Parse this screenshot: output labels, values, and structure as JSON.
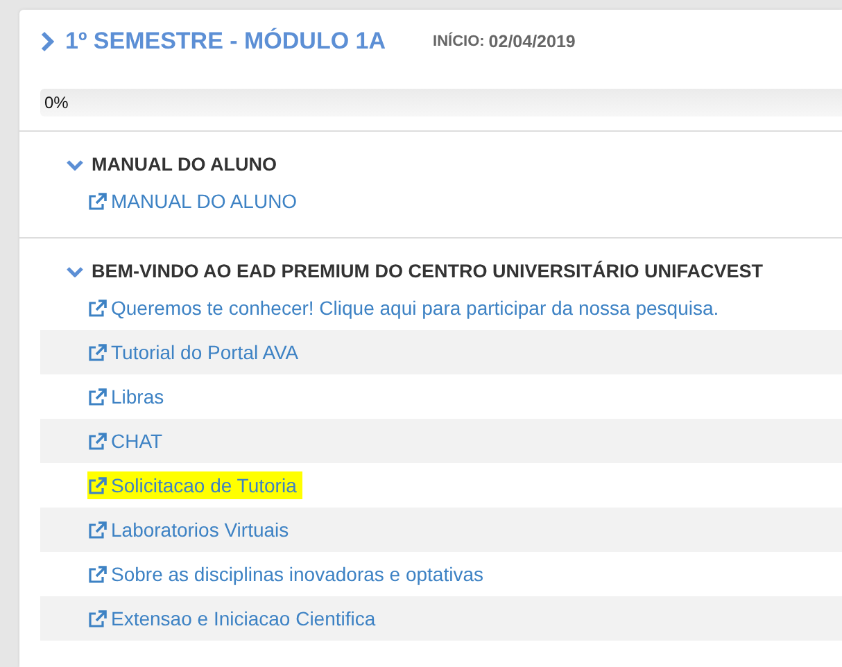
{
  "course": {
    "title": "1º SEMESTRE - MÓDULO 1A",
    "start_label": "INÍCIO:",
    "start_date": "02/04/2019"
  },
  "progress": {
    "level": 0,
    "reading": "0%"
  },
  "sections": [
    {
      "title": "MANUAL DO ALUNO",
      "expanded": true,
      "links": [
        {
          "label": "MANUAL DO ALUNO",
          "highlighted": false
        }
      ]
    },
    {
      "title": "BEM-VINDO AO EAD PREMIUM DO CENTRO UNIVERSITÁRIO UNIFACVEST",
      "expanded": true,
      "links": [
        {
          "label": "Queremos te conhecer! Clique aqui para participar da nossa pesquisa.",
          "highlighted": false
        },
        {
          "label": "Tutorial do Portal AVA",
          "highlighted": false
        },
        {
          "label": "Libras",
          "highlighted": false
        },
        {
          "label": "CHAT",
          "highlighted": false
        },
        {
          "label": "Solicitacao de Tutoria",
          "highlighted": true
        },
        {
          "label": "Laboratorios Virtuais",
          "highlighted": false
        },
        {
          "label": "Sobre as disciplinas inovadoras e optativas",
          "highlighted": false
        },
        {
          "label": "Extensao e Iniciacao Cientifica",
          "highlighted": false
        }
      ]
    }
  ]
}
